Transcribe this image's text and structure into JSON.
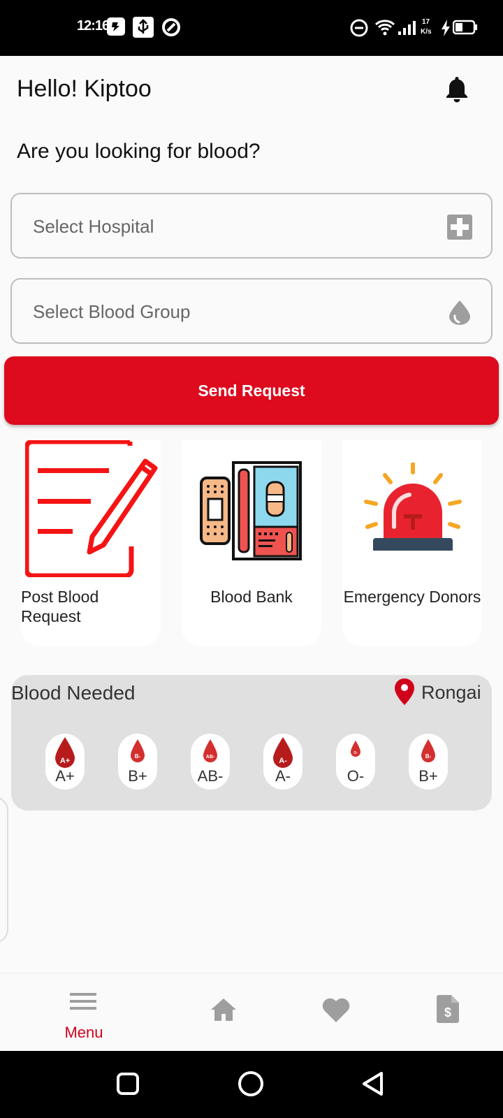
{
  "status_bar": {
    "time": "12:16",
    "net_speed_value": "17",
    "net_speed_unit": "K/s"
  },
  "header": {
    "greeting": "Hello! Kiptoo"
  },
  "request_form": {
    "question": "Are you looking for blood?",
    "hospital_placeholder": "Select Hospital",
    "blood_group_placeholder": "Select Blood Group",
    "send_label": "Send Request"
  },
  "actions": [
    {
      "label": "Post Blood Request",
      "icon": "edit-document-icon"
    },
    {
      "label": "Blood Bank",
      "icon": "blood-bank-icon"
    },
    {
      "label": "Emergency Donors",
      "icon": "emergency-siren-icon"
    }
  ],
  "blood_needed": {
    "title": "Blood Needed",
    "location": "Rongai",
    "groups": [
      "A+",
      "B+",
      "AB-",
      "A-",
      "O-",
      "B+"
    ],
    "drop_labels": [
      "A+",
      "B-",
      "AB-",
      "A-",
      "O-",
      "B-"
    ]
  },
  "bottom_nav": {
    "menu_label": "Menu",
    "items": [
      "menu-icon",
      "home-icon",
      "heart-icon",
      "invoice-dollar-icon"
    ]
  },
  "colors": {
    "primary_red": "#de0a1e",
    "active_nav": "#d0021b",
    "inactive_icon": "#9e9e9e"
  }
}
